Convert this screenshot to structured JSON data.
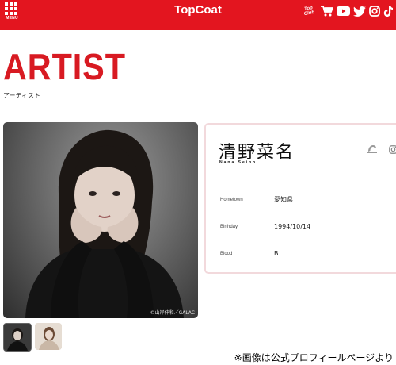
{
  "header": {
    "menu_label": "MENU",
    "logo": "TopCoat",
    "icons": [
      "topcoat-club-logo",
      "cart-icon",
      "youtube-icon",
      "twitter-icon",
      "instagram-icon",
      "tiktok-icon"
    ],
    "club_logo_text": "Top Club",
    "background_color": "#e3151f"
  },
  "page": {
    "title": "ARTIST",
    "subtitle": "アーティスト",
    "accent_color": "#d81a22"
  },
  "photo": {
    "credit": "©山岸伸和／GALAC",
    "thumbnail_count": 2
  },
  "artist": {
    "name": "清野菜名",
    "name_roman": "Nana Seino",
    "social_icons": [
      "topcoat-club-icon",
      "instagram-icon"
    ],
    "profile": [
      {
        "label": "Hometown",
        "value": "愛知県"
      },
      {
        "label": "Birthday",
        "value": "1994/10/14"
      },
      {
        "label": "Blood",
        "value": "B"
      }
    ]
  },
  "source_note": "※画像は公式プロフィールページより"
}
